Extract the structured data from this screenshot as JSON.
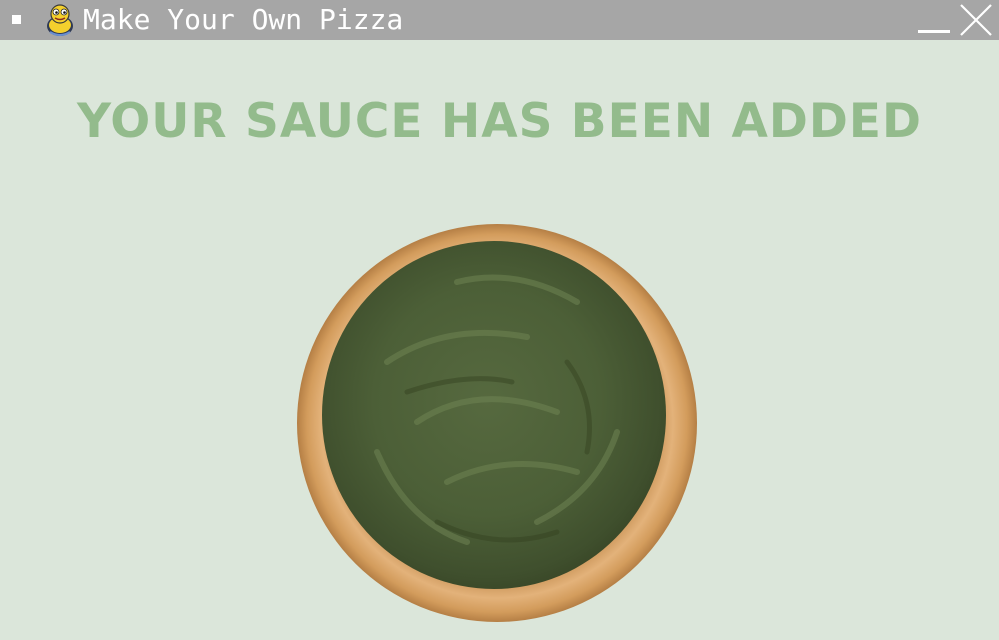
{
  "window": {
    "title": "Make Your Own Pizza",
    "icons": {
      "menu": "window-menu-icon",
      "app": "pygame-snake-icon",
      "minimize": "minimize-icon",
      "close": "close-icon"
    }
  },
  "main": {
    "message": "YOUR SAUCE HAS BEEN ADDED",
    "image": "pizza-crust-with-pesto-sauce"
  },
  "colors": {
    "titlebar": "#a6a6a6",
    "background": "#dbe6da",
    "headline": "#93bb8c",
    "crust": "#d6a46a",
    "sauce": "#55693f"
  }
}
